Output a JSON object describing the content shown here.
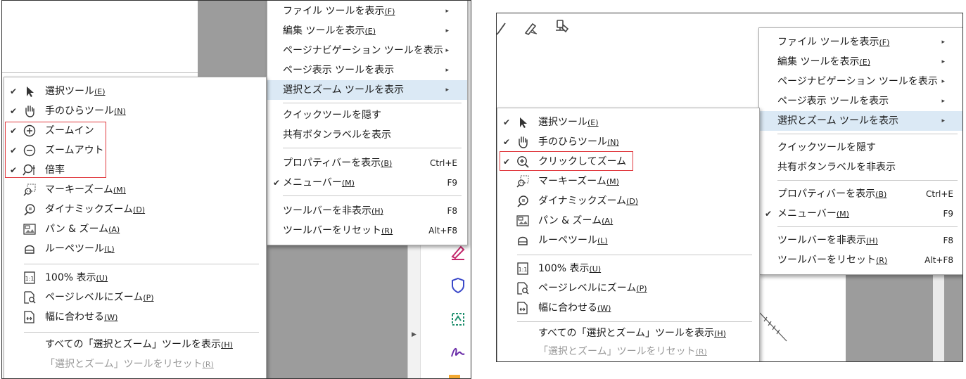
{
  "panel1": {
    "main_menu": {
      "items": [
        {
          "label": "ファイル ツールを表示",
          "accel": "(F)",
          "arrow": "▸"
        },
        {
          "label": "編集 ツールを表示",
          "accel": "(E)",
          "arrow": "▸"
        },
        {
          "label": "ページナビゲーション ツールを表示",
          "accel": "",
          "arrow": "▸"
        },
        {
          "label": "ページ表示 ツールを表示",
          "accel": "",
          "arrow": "▸"
        },
        {
          "label": "選択とズーム ツールを表示",
          "accel": "",
          "arrow": "▸"
        },
        {
          "label": "クイックツールを隠す",
          "accel": ""
        },
        {
          "label": "共有ボタンラベルを表示",
          "accel": ""
        },
        {
          "label": "プロパティバーを表示",
          "accel": "(B)",
          "shortcut": "Ctrl+E"
        },
        {
          "label": "メニューバー",
          "accel": "(M)",
          "shortcut": "F9",
          "check": "✔"
        },
        {
          "label": "ツールバーを非表示",
          "accel": "(H)",
          "shortcut": "F8"
        },
        {
          "label": "ツールバーをリセット",
          "accel": "(R)",
          "shortcut": "Alt+F8"
        }
      ]
    },
    "sub_menu": {
      "items": [
        {
          "label": "選択ツール",
          "accel": "(E)",
          "check": "✔",
          "icon": "arrow-pointer-icon"
        },
        {
          "label": "手のひらツール",
          "accel": "(N)",
          "check": "✔",
          "icon": "hand-icon"
        },
        {
          "label": "ズームイン",
          "accel": "",
          "check": "✔",
          "icon": "zoom-in-icon"
        },
        {
          "label": "ズームアウト",
          "accel": "",
          "check": "✔",
          "icon": "zoom-out-icon"
        },
        {
          "label": "倍率",
          "accel": "",
          "check": "✔",
          "icon": "zoom-ratio-icon"
        },
        {
          "label": "マーキーズーム",
          "accel": "(M)",
          "icon": "marquee-zoom-icon"
        },
        {
          "label": "ダイナミックズーム",
          "accel": "(D)",
          "icon": "dynamic-zoom-icon"
        },
        {
          "label": "パン & ズーム",
          "accel": "(A)",
          "icon": "pan-zoom-icon"
        },
        {
          "label": "ルーペツール",
          "accel": "(L)",
          "icon": "loupe-icon"
        },
        {
          "label": "100% 表示",
          "accel": "(U)",
          "icon": "actual-size-icon"
        },
        {
          "label": "ページレベルにズーム",
          "accel": "(P)",
          "icon": "fit-page-icon"
        },
        {
          "label": "幅に合わせる",
          "accel": "(W)",
          "icon": "fit-width-icon"
        },
        {
          "label": "すべての「選択とズーム」ツールを表示",
          "accel": "(H)"
        },
        {
          "label": "「選択とズーム」ツールをリセット",
          "accel": "(R)",
          "disabled": true
        }
      ]
    }
  },
  "panel2": {
    "main_menu": {
      "items": [
        {
          "label": "ファイル ツールを表示",
          "accel": "(F)",
          "arrow": "▸"
        },
        {
          "label": "編集 ツールを表示",
          "accel": "(E)",
          "arrow": "▸"
        },
        {
          "label": "ページナビゲーション ツールを表示",
          "accel": "",
          "arrow": "▸"
        },
        {
          "label": "ページ表示 ツールを表示",
          "accel": "",
          "arrow": "▸"
        },
        {
          "label": "選択とズーム ツールを表示",
          "accel": "",
          "arrow": "▸"
        },
        {
          "label": "クイックツールを隠す",
          "accel": ""
        },
        {
          "label": "共有ボタンラベルを非表示",
          "accel": ""
        },
        {
          "label": "プロパティバーを表示",
          "accel": "(B)",
          "shortcut": "Ctrl+E"
        },
        {
          "label": "メニューバー",
          "accel": "(M)",
          "shortcut": "F9",
          "check": "✔"
        },
        {
          "label": "ツールバーを非表示",
          "accel": "(H)",
          "shortcut": "F8"
        },
        {
          "label": "ツールバーをリセット",
          "accel": "(R)",
          "shortcut": "Alt+F8"
        }
      ]
    },
    "sub_menu": {
      "items": [
        {
          "label": "選択ツール",
          "accel": "(E)",
          "check": "✔",
          "icon": "arrow-pointer-icon"
        },
        {
          "label": "手のひらツール",
          "accel": "(N)",
          "check": "✔",
          "icon": "hand-icon"
        },
        {
          "label": "クリックしてズーム",
          "accel": "",
          "check": "✔",
          "icon": "click-zoom-icon"
        },
        {
          "label": "マーキーズーム",
          "accel": "(M)",
          "icon": "marquee-zoom-icon"
        },
        {
          "label": "ダイナミックズーム",
          "accel": "(D)",
          "icon": "dynamic-zoom-icon"
        },
        {
          "label": "パン & ズーム",
          "accel": "(A)",
          "icon": "pan-zoom-icon"
        },
        {
          "label": "ルーペツール",
          "accel": "(L)",
          "icon": "loupe-icon"
        },
        {
          "label": "100% 表示",
          "accel": "(U)",
          "icon": "actual-size-icon"
        },
        {
          "label": "ページレベルにズーム",
          "accel": "(P)",
          "icon": "fit-page-icon"
        },
        {
          "label": "幅に合わせる",
          "accel": "(W)",
          "icon": "fit-width-icon"
        },
        {
          "label": "すべての「選択とズーム」ツールを表示",
          "accel": "(H)"
        },
        {
          "label": "「選択とズーム」ツールをリセット",
          "accel": "(R)",
          "disabled": true
        }
      ]
    }
  },
  "colors": {
    "highlight": "#dbe9f5",
    "annotation_red": "#e0393e",
    "gray": "#9c9c9c"
  }
}
